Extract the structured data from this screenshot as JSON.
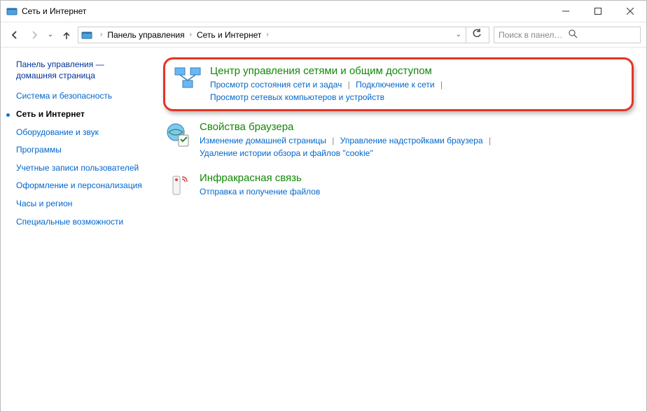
{
  "window": {
    "title": "Сеть и Интернет"
  },
  "address": {
    "seg1": "Панель управления",
    "seg2": "Сеть и Интернет"
  },
  "search": {
    "placeholder": "Поиск в панели управления"
  },
  "sidebar": {
    "home_line1": "Панель управления —",
    "home_line2": "домашняя страница",
    "items": [
      {
        "label": "Система и безопасность",
        "active": false
      },
      {
        "label": "Сеть и Интернет",
        "active": true
      },
      {
        "label": "Оборудование и звук",
        "active": false
      },
      {
        "label": "Программы",
        "active": false
      },
      {
        "label": "Учетные записи пользователей",
        "active": false
      },
      {
        "label": "Оформление и персонализация",
        "active": false
      },
      {
        "label": "Часы и регион",
        "active": false
      },
      {
        "label": "Специальные возможности",
        "active": false
      }
    ]
  },
  "categories": [
    {
      "title": "Центр управления сетями и общим доступом",
      "links": [
        "Просмотр состояния сети и задач",
        "Подключение к сети",
        "Просмотр сетевых компьютеров и устройств"
      ],
      "highlighted": true
    },
    {
      "title": "Свойства браузера",
      "links": [
        "Изменение домашней страницы",
        "Управление надстройками браузера",
        "Удаление истории обзора и файлов \"cookie\""
      ],
      "highlighted": false
    },
    {
      "title": "Инфракрасная связь",
      "links": [
        "Отправка и получение файлов"
      ],
      "highlighted": false
    }
  ]
}
